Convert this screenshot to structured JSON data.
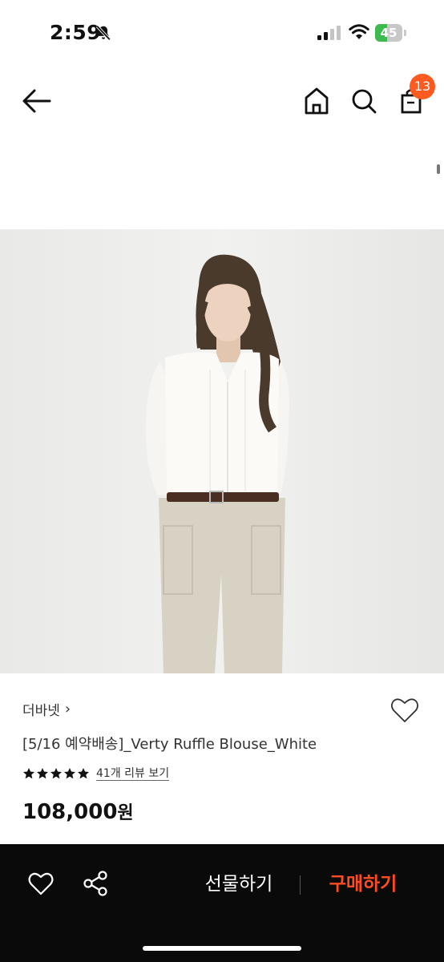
{
  "status_bar": {
    "time": "2:59",
    "battery_level": "45",
    "battery_percent": 45,
    "icons": [
      "bell-off-icon",
      "signal-icon",
      "wifi-icon",
      "battery-icon"
    ]
  },
  "header": {
    "icons": [
      "back-arrow-icon",
      "home-icon",
      "search-icon",
      "shopping-bag-icon"
    ],
    "cart_count": "13"
  },
  "product": {
    "brand": "더바넷",
    "brand_chevron": "›",
    "name": "[5/16 예약배송]_Verty Ruffle Blouse_White",
    "rating_stars": 5,
    "review_link": "41개 리뷰 보기",
    "price": "108,000",
    "price_unit": "원"
  },
  "bottom_bar": {
    "gift_label": "선물하기",
    "buy_label": "구매하기",
    "icons": [
      "heart-icon",
      "share-icon"
    ]
  },
  "colors": {
    "accent": "#ff5a1f",
    "buy": "#ff4d1f",
    "bottom_bar_bg": "#0a0a0a",
    "battery_fill": "#3dbb4f"
  }
}
